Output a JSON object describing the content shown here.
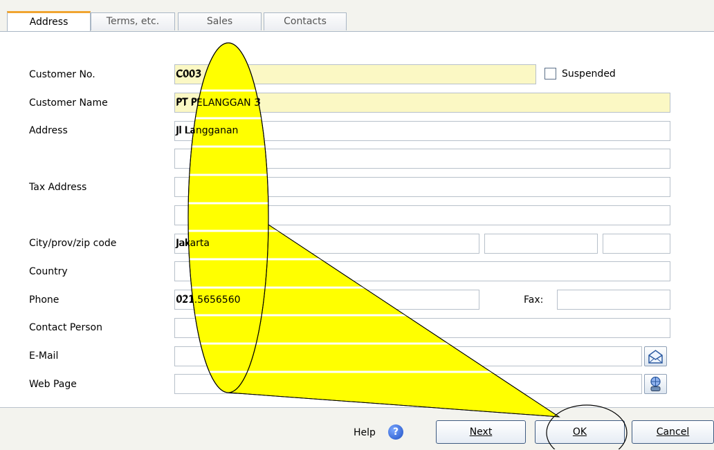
{
  "tabs": [
    {
      "label": "Address",
      "active": true
    },
    {
      "label": "Terms, etc.",
      "active": false
    },
    {
      "label": "Sales",
      "active": false
    },
    {
      "label": "Contacts",
      "active": false
    }
  ],
  "form": {
    "customer_no_label": "Customer No.",
    "customer_no": "C003",
    "suspended_label": "Suspended",
    "suspended": false,
    "customer_name_label": "Customer Name",
    "customer_name": "PT PELANGGAN 3",
    "address_label": "Address",
    "address_line1": "Jl Langganan",
    "address_line2": "",
    "tax_address_label": "Tax Address",
    "tax_address_line1": "",
    "tax_address_line2": "",
    "city_label": "City/prov/zip code",
    "city": "Jakarta",
    "province": "",
    "zip": "",
    "country_label": "Country",
    "country": "",
    "phone_label": "Phone",
    "phone": "021.5656560",
    "fax_label": "Fax:",
    "fax": "",
    "contact_person_label": "Contact Person",
    "contact_person": "",
    "email_label": "E-Mail",
    "email": "",
    "web_page_label": "Web Page",
    "web_page": ""
  },
  "footer": {
    "help_label": "Help",
    "next_label": "Next",
    "ok_label": "OK",
    "cancel_label": "Cancel"
  },
  "icons": [
    "email-icon",
    "web-icon",
    "help-icon"
  ],
  "colors": {
    "required_field_bg": "#fbf8c4",
    "highlight": "#ffff00",
    "active_tab_accent": "#f0a530"
  }
}
